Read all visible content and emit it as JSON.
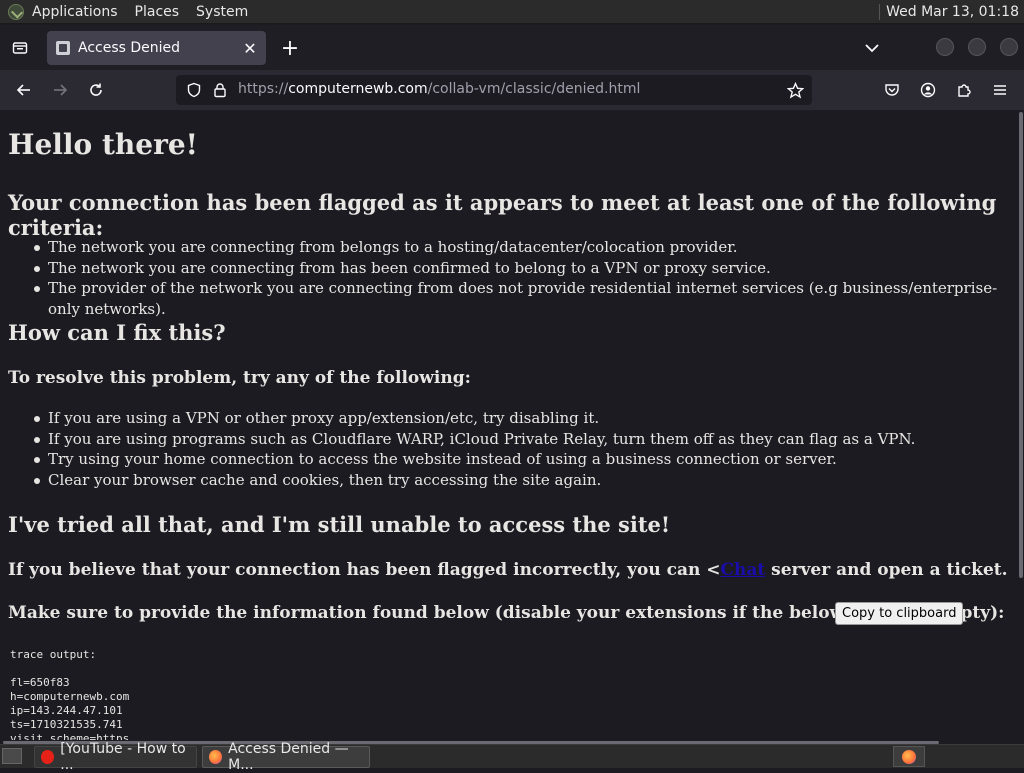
{
  "top_panel": {
    "menus": [
      "Applications",
      "Places",
      "System"
    ],
    "clock": "Wed Mar 13, 01:18"
  },
  "browser": {
    "tab": {
      "title": "Access Denied"
    },
    "url": {
      "scheme": "https://",
      "host": "computernewb.com",
      "path": "/collab-vm/classic/denied.html"
    }
  },
  "page": {
    "h1": "Hello there!",
    "h2_flagged": "Your connection has been flagged as it appears to meet at least one of the following criteria:",
    "criteria": [
      "The network you are connecting from belongs to a hosting/datacenter/colocation provider.",
      "The network you are connecting from has been confirmed to belong to a VPN or proxy service.",
      "The provider of the network you are connecting from does not provide residential internet services (e.g business/enterprise-only networks)."
    ],
    "h2_fix": "How can I fix this?",
    "h3_resolve": "To resolve this problem, try any of the following:",
    "fixes": [
      "If you are using a VPN or other proxy app/extension/etc, try disabling it.",
      "If you are using programs such as Cloudflare WARP, iCloud Private Relay, turn them off as they can flag as a VPN.",
      "Try using your home connection to access the website instead of using a business connection or server.",
      "Clear your browser cache and cookies, then try accessing the site again."
    ],
    "h2_tried": "I've tried all that, and I'm still unable to access the site!",
    "believe": {
      "before": "If you believe that your connection has been flagged incorrectly, you can <",
      "link": "Chat",
      "after": " server and open a ticket."
    },
    "provide_info": "Make sure to provide the information found below (disable your extensions if the below space is empty):",
    "copy_button": "Copy to clipboard",
    "trace_lines": [
      "trace output:",
      "",
      "fl=650f83",
      "h=computernewb.com",
      "ip=143.244.47.101",
      "ts=1710321535.741",
      "visit_scheme=https"
    ]
  },
  "taskbar": {
    "tasks": [
      "[YouTube - How to ...",
      "Access Denied — M..."
    ]
  },
  "colors": {
    "page_bg": "#1c1b22",
    "link": "#1a0dab",
    "tab_active": "#42414d",
    "youtube_red": "#e62117",
    "firefox_orange": "#ff7139"
  }
}
